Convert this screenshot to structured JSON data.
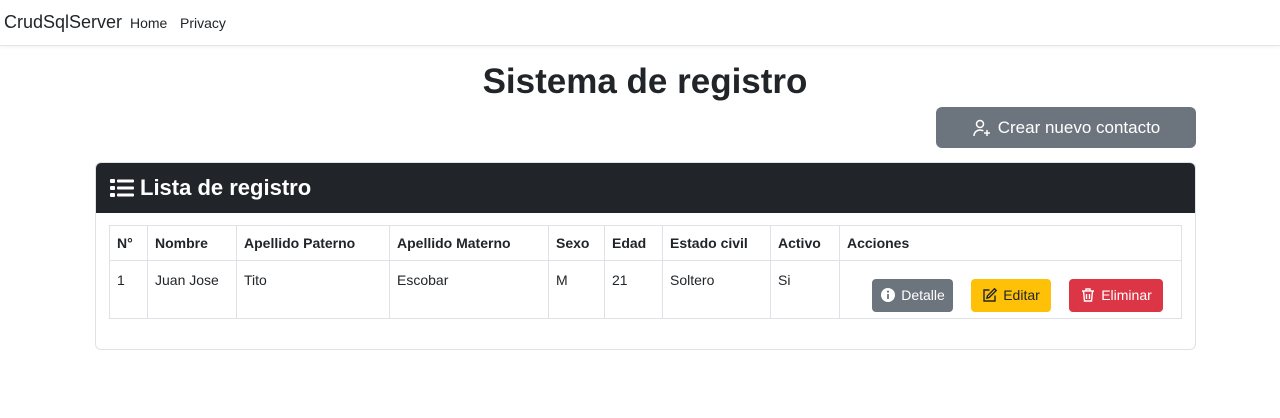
{
  "navbar": {
    "brand": "CrudSqlServer",
    "links": [
      "Home",
      "Privacy"
    ]
  },
  "page": {
    "title": "Sistema de registro",
    "create_button": "Crear nuevo contacto"
  },
  "card": {
    "title": "Lista de registro",
    "icon": "list-icon"
  },
  "table": {
    "headers": [
      "N°",
      "Nombre",
      "Apellido Paterno",
      "Apellido Materno",
      "Sexo",
      "Edad",
      "Estado civil",
      "Activo",
      "Acciones"
    ],
    "rows": [
      {
        "num": "1",
        "nombre": "Juan Jose",
        "paterno": "Tito",
        "materno": "Escobar",
        "sexo": "M",
        "edad": "21",
        "estado": "Soltero",
        "activo": "Si"
      }
    ],
    "actions": {
      "detalle": "Detalle",
      "editar": "Editar",
      "eliminar": "Eliminar"
    }
  },
  "colors": {
    "secondary": "#6c757d",
    "warning": "#ffc107",
    "danger": "#dc3545",
    "dark": "#212529"
  }
}
